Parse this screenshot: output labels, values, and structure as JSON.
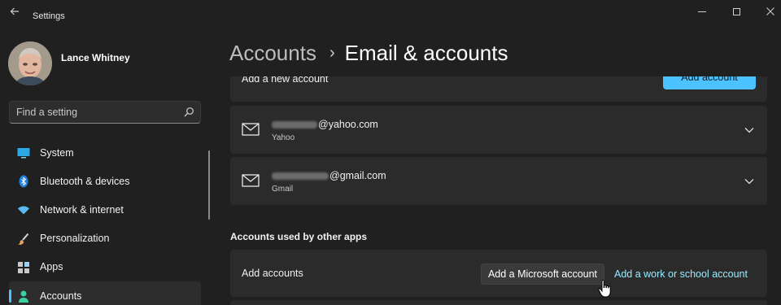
{
  "window": {
    "title": "Settings",
    "back_icon": "arrow-left-icon",
    "controls": [
      "minimize-icon",
      "maximize-icon",
      "close-icon"
    ]
  },
  "user": {
    "name": "Lance Whitney",
    "avatar_icon": "user-photo"
  },
  "search": {
    "placeholder": "Find a setting",
    "icon": "search-icon"
  },
  "nav": {
    "active": "Accounts",
    "items": [
      {
        "label": "System",
        "icon": "system-icon",
        "color": "#2ea8e5"
      },
      {
        "label": "Bluetooth & devices",
        "icon": "bluetooth-icon",
        "color": "#1f7fdc"
      },
      {
        "label": "Network & internet",
        "icon": "wifi-icon",
        "color": "#59b9f2"
      },
      {
        "label": "Personalization",
        "icon": "brush-icon",
        "color": "#e0e0e0"
      },
      {
        "label": "Apps",
        "icon": "apps-icon",
        "color": "#c9c9c9"
      },
      {
        "label": "Accounts",
        "icon": "person-icon",
        "color": "#3bd1a5"
      }
    ]
  },
  "breadcrumb": {
    "parent": "Accounts",
    "separator": "›",
    "current": "Email & accounts"
  },
  "main": {
    "add_new": {
      "label": "Add a new account",
      "button": "Add account"
    },
    "accounts": [
      {
        "email_domain": "@yahoo.com",
        "provider": "Yahoo"
      },
      {
        "email_domain": "@gmail.com",
        "provider": "Gmail"
      }
    ],
    "other_apps": {
      "heading": "Accounts used by other apps",
      "label": "Add accounts",
      "microsoft_button": "Add a Microsoft account",
      "work_link": "Add a work or school account"
    }
  },
  "colors": {
    "accent": "#4cc2ff",
    "link": "#99ebff",
    "background": "#202020",
    "card": "#2b2b2b"
  }
}
